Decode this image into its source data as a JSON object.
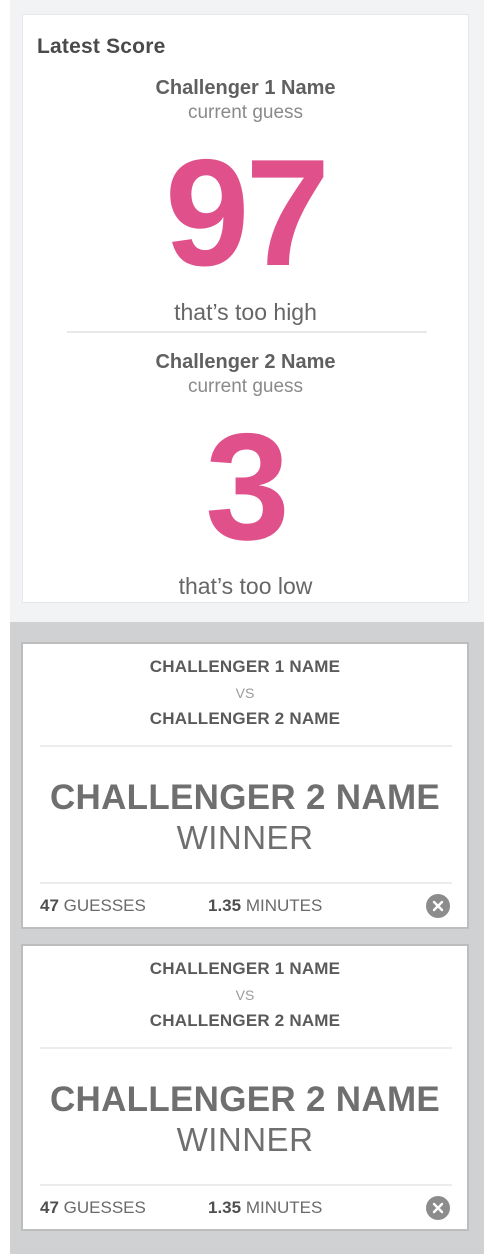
{
  "latest_score": {
    "title": "Latest Score",
    "players": [
      {
        "name": "Challenger 1 Name",
        "sub_label": "current guess",
        "guess": "97",
        "verdict": "that’s too high"
      },
      {
        "name": "Challenger 2 Name",
        "sub_label": "current guess",
        "guess": "3",
        "verdict": "that’s too low"
      }
    ]
  },
  "matches": [
    {
      "challenger1": "CHALLENGER 1 NAME",
      "vs_label": "VS",
      "challenger2": "CHALLENGER 2 NAME",
      "winner_name": "CHALLENGER 2 NAME",
      "winner_label": "WINNER",
      "guesses_value": "47",
      "guesses_label": "GUESSES",
      "minutes_value": "1.35",
      "minutes_label": "MINUTES"
    },
    {
      "challenger1": "CHALLENGER 1 NAME",
      "vs_label": "VS",
      "challenger2": "CHALLENGER 2 NAME",
      "winner_name": "CHALLENGER 2 NAME",
      "winner_label": "WINNER",
      "guesses_value": "47",
      "guesses_label": "GUESSES",
      "minutes_value": "1.35",
      "minutes_label": "MINUTES"
    }
  ],
  "icons": {
    "remove": "close-circle-icon"
  },
  "colors": {
    "guess_accent": "#e0508a",
    "history_background": "#d0d1d3",
    "score_background": "#f2f3f5"
  }
}
